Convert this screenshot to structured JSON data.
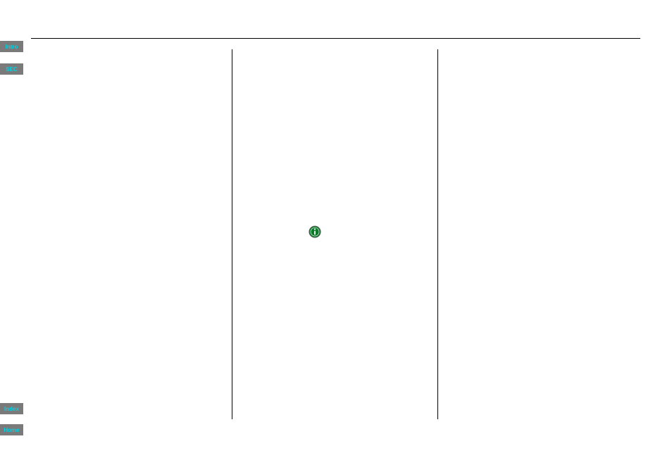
{
  "sidebar": {
    "intro_label": "Intro",
    "sec_label": "SEC",
    "index_label": "Index",
    "home_label": "Home"
  },
  "icons": {
    "info": "info-icon"
  }
}
